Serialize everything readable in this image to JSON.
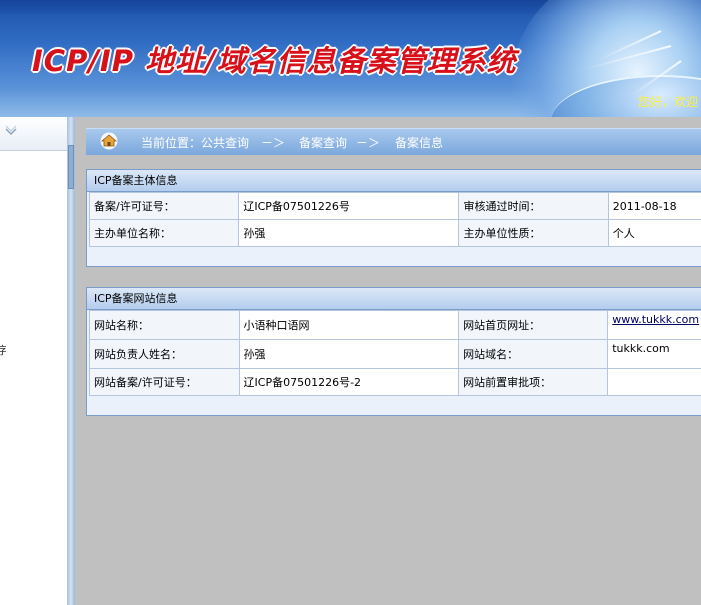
{
  "header": {
    "title": "ICP/IP 地址/域名信息备案管理系统",
    "greeting": "您好，欢迎"
  },
  "breadcrumb": {
    "prefix": "当前位置：公共查询",
    "sep1": "－＞",
    "item2": "备案查询",
    "sep2": "－＞",
    "item3": "备案信息"
  },
  "left_panel": {
    "fragment": "字"
  },
  "entity_panel": {
    "title": "ICP备案主体信息",
    "rows": [
      {
        "label1": "备案/许可证号：",
        "value1": "辽ICP备07501226号",
        "label2": "审核通过时间：",
        "value2": "2011-08-18"
      },
      {
        "label1": "主办单位名称：",
        "value1": "孙强",
        "label2": "主办单位性质：",
        "value2": "个人"
      }
    ]
  },
  "site_panel": {
    "title": "ICP备案网站信息",
    "rows": [
      {
        "label1": "网站名称：",
        "value1": "小语种口语网",
        "label2": "网站首页网址：",
        "value2": "www.tukkk.com"
      },
      {
        "label1": "网站负责人姓名：",
        "value1": "孙强",
        "label2": "网站域名：",
        "value2": "tukkk.com"
      },
      {
        "label1": "网站备案/许可证号：",
        "value1": "辽ICP备07501226号-2",
        "label2": "网站前置审批项：",
        "value2": ""
      }
    ]
  }
}
